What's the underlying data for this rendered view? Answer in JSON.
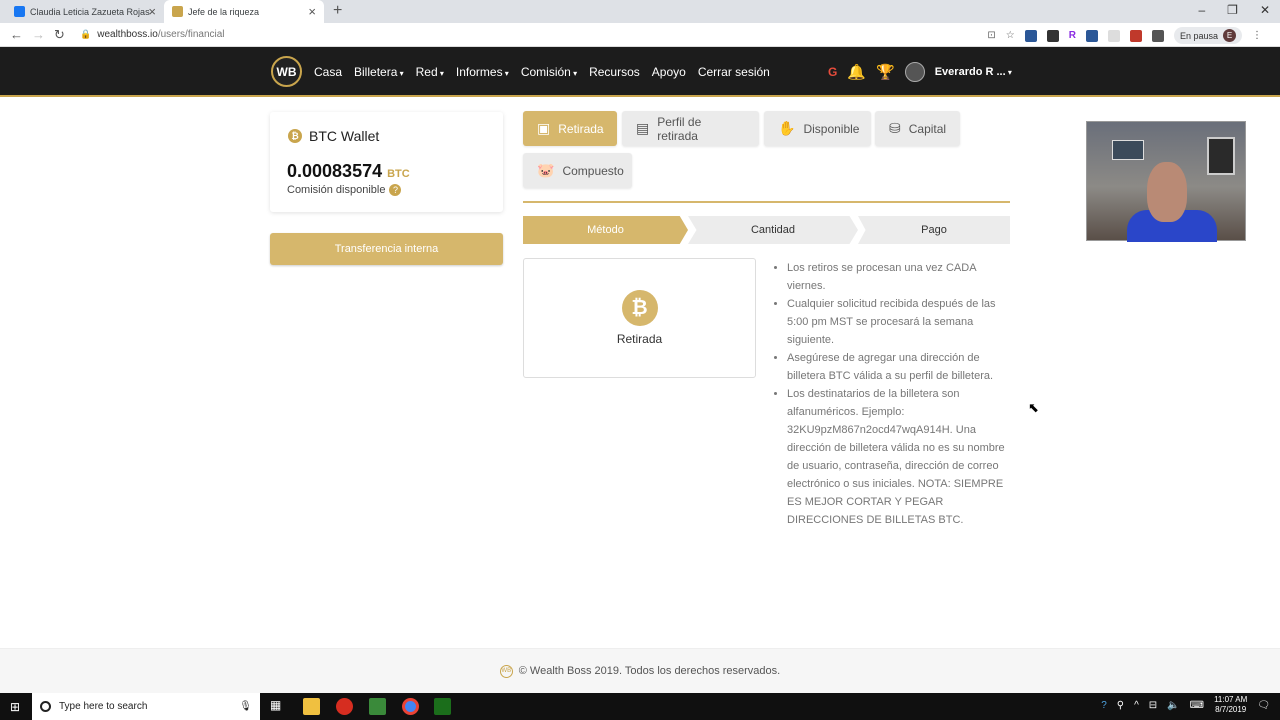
{
  "browser": {
    "tabs": [
      {
        "title": "Claudia Leticia Zazueta Rojas",
        "favicon_color": "#1877f2"
      },
      {
        "title": "Jefe de la riqueza",
        "favicon_color": "#c9a54d"
      }
    ],
    "url_host": "wealthboss.io",
    "url_path": "/users/financial",
    "profile_status": "En pausa",
    "profile_initial": "E"
  },
  "navbar": {
    "logo": "WB",
    "menu": [
      {
        "label": "Casa",
        "dropdown": false
      },
      {
        "label": "Billetera",
        "dropdown": true
      },
      {
        "label": "Red",
        "dropdown": true
      },
      {
        "label": "Informes",
        "dropdown": true
      },
      {
        "label": "Comisión",
        "dropdown": true
      },
      {
        "label": "Recursos",
        "dropdown": false
      },
      {
        "label": "Apoyo",
        "dropdown": false
      },
      {
        "label": "Cerrar sesión",
        "dropdown": false
      }
    ],
    "user_name": "Everardo R ..."
  },
  "wallet": {
    "title": "BTC Wallet",
    "amount": "0.00083574",
    "unit": "BTC",
    "label": "Comisión disponible"
  },
  "transfer_button": "Transferencia interna",
  "actions": [
    {
      "label": "Retirada",
      "icon": "withdraw-icon",
      "active": true
    },
    {
      "label": "Perfil de retirada",
      "icon": "wallet-profile-icon",
      "active": false
    },
    {
      "label": "Disponible",
      "icon": "hand-coin-icon",
      "active": false
    },
    {
      "label": "Capital",
      "icon": "coins-icon",
      "active": false
    },
    {
      "label": "Compuesto",
      "icon": "piggy-bank-icon",
      "active": false
    }
  ],
  "steps": [
    "Método",
    "Cantidad",
    "Pago"
  ],
  "method": {
    "label": "Retirada"
  },
  "notes": [
    "Los retiros se procesan una vez CADA viernes.",
    "Cualquier solicitud recibida después de las 5:00 pm MST se procesará la semana siguiente.",
    "Asegúrese de agregar una dirección de billetera BTC válida a su perfil de billetera.",
    "Los destinatarios de la billetera son alfanuméricos. Ejemplo: 32KU9pzM867n2ocd47wqA914H. Una dirección de billetera válida no es su nombre de usuario, contraseña, dirección de correo electrónico o sus iniciales. NOTA: SIEMPRE ES MEJOR CORTAR Y PEGAR DIRECCIONES DE BILLETAS BTC."
  ],
  "footer": "© Wealth Boss 2019. Todos los derechos reservados.",
  "taskbar": {
    "search_placeholder": "Type here to search",
    "time": "11:07 AM",
    "date": "8/7/2019"
  },
  "colors": {
    "accent": "#d6b76c",
    "navbar": "#1c1c1c"
  }
}
